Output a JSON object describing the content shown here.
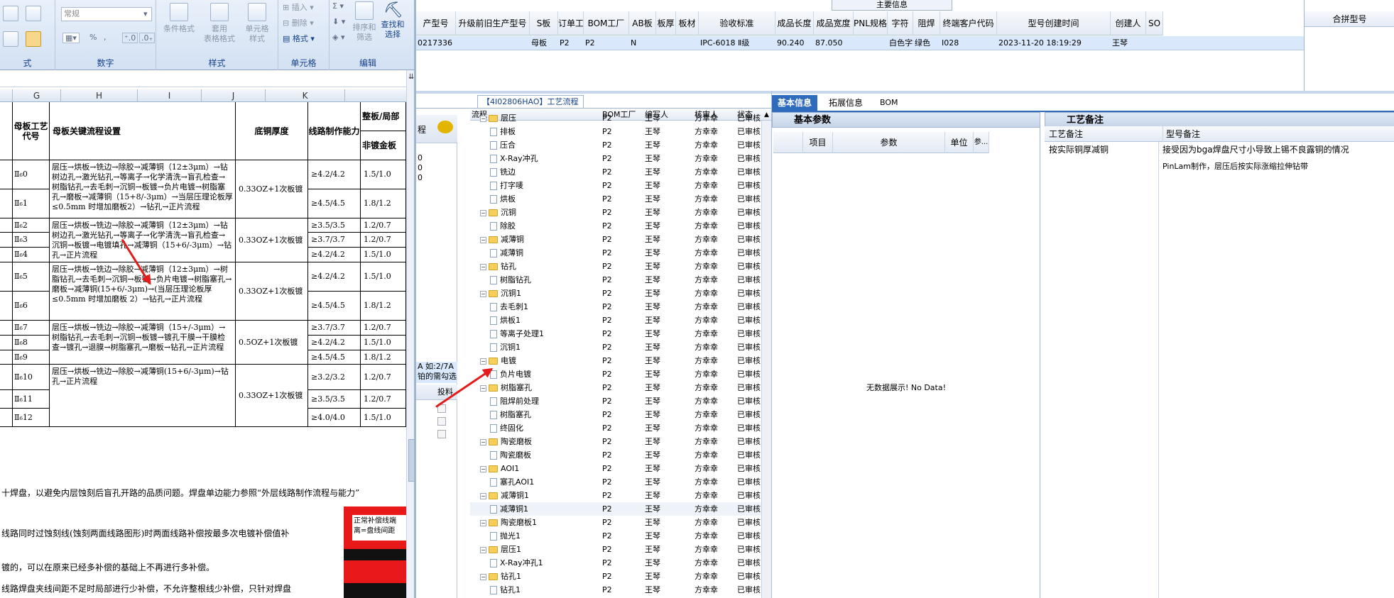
{
  "excel": {
    "ribbon": {
      "number_format_value": "常规",
      "groups": [
        {
          "label": "式"
        },
        {
          "label": "数字"
        },
        {
          "label": "样式"
        },
        {
          "label": "单元格"
        },
        {
          "label": "编辑"
        }
      ],
      "style_buttons": [
        {
          "label": "条件格式"
        },
        {
          "label": "套用\n表格格式"
        },
        {
          "label": "单元格\n样式"
        }
      ],
      "cell_items": [
        "插入",
        "删除",
        "格式"
      ],
      "edit_items": [
        "Σ",
        "排序和\n筛选",
        "查找和\n选择"
      ],
      "percent": "%",
      "comma": ","
    },
    "columns": [
      "G",
      "H",
      "I",
      "J",
      "K"
    ],
    "headers": {
      "code": "母板工艺代号",
      "flow": "母板关键流程设置",
      "cu": "底铜厚度",
      "line": "线路制作能力",
      "plate": "整板/局部",
      "plate_sub": "非镀金板"
    },
    "rows": [
      {
        "code": "Ⅱ₆0",
        "line": "≥4.2/4.2",
        "plate": "1.5/1.0"
      },
      {
        "code": "Ⅱ₆1",
        "line": "≥4.5/4.5",
        "plate": "1.8/1.2"
      },
      {
        "code": "Ⅱ₆2",
        "line": "≥3.5/3.5",
        "plate": "1.2/0.7"
      },
      {
        "code": "Ⅱ₆3",
        "line": "≥3.7/3.7",
        "plate": "1.2/0.7"
      },
      {
        "code": "Ⅱ₆4",
        "line": "≥4.2/4.2",
        "plate": "1.5/1.0"
      },
      {
        "code": "Ⅱ₆5",
        "line": "≥4.2/4.2",
        "plate": "1.5/1.0"
      },
      {
        "code": "Ⅱ₆6",
        "line": "≥4.5/4.5",
        "plate": "1.8/1.2"
      },
      {
        "code": "Ⅱ₆7",
        "line": "≥3.7/3.7",
        "plate": "1.2/0.7"
      },
      {
        "code": "Ⅱ₆8",
        "line": "≥4.2/4.2",
        "plate": "1.5/1.0"
      },
      {
        "code": "Ⅱ₆9",
        "line": "≥4.5/4.5",
        "plate": "1.8/1.2"
      },
      {
        "code": "Ⅱ₆10",
        "line": "≥3.2/3.2",
        "plate": "1.2/0.7"
      },
      {
        "code": "Ⅱ₆11",
        "line": "≥3.5/3.5",
        "plate": "1.2/0.7"
      },
      {
        "code": "Ⅱ₆12",
        "line": "≥4.0/4.0",
        "plate": "1.5/1.0"
      }
    ],
    "flows": [
      {
        "text": "层压→烘板→铣边→除胶→减薄铜（12±3μm）→钻树边孔→激光钻孔→等离子→化学清洗→盲孔检查→树脂钻孔→去毛刺→沉铜→板镀→负片电镀→树脂塞孔→磨板→减薄铜（15+8/-3μm）→当层压理论板厚≤0.5mm 时增加磨板2）→钻孔→正片流程",
        "cu": "0.33OZ+1次板镀"
      },
      {
        "text": "层压→烘板→铣边→除胶→减薄铜（12±3μm）→钻树边孔→激光钻孔→等离子→化学清洗→盲孔检查→沉铜→板镀→电镀填孔→减薄铜（15+6/-3μm）→钻孔→正片流程",
        "cu": "0.33OZ+1次板镀"
      },
      {
        "text": "层压→烘板→铣边→除胶→减薄铜（12±3μm）→树脂钻孔→去毛刺→沉铜→板镀→负片电镀→树脂塞孔→磨板→减薄铜(15+6/-3μm)→(当层压理论板厚≤0.5mm 时增加磨板 2）→钻孔→正片流程",
        "cu": "0.33OZ+1次板镀"
      },
      {
        "text": "层压→烘板→铣边→除胶→减薄铜（15+/-3μm）→树脂钻孔→去毛刺→沉铜→板镀→镀孔干膜→干膜检查→镀孔→退膜→树脂塞孔→磨板→钻孔→正片流程",
        "cu": "0.5OZ+1次板镀"
      },
      {
        "text": "层压→烘板→铣边→除胶→减薄铜(15+6/-3μm)→钻孔→正片流程",
        "cu": "0.33OZ+1次板镀"
      }
    ],
    "doc_lines": [
      "十焊盘，以避免内层蚀刻后盲孔开路的品质问题。焊盘单边能力参照“外层线路制作流程与能力”",
      "线路同时过蚀刻线(蚀刻两面线路图形)时两面线路补偿按最多次电镀补偿值补",
      "镀的，可以在原来已经多补偿的基础上不再进行多补偿。",
      "线路焊盘夹线间距不足时局部进行少补偿，不允许整根线少补偿，只针对焊盘"
    ],
    "note_box": {
      "line1": "正常补偿线端",
      "line2": "离=盘线间距"
    }
  },
  "topgrid": {
    "caption": "主要信息",
    "merge_header": "合拼型号",
    "headers": [
      "产型号",
      "升级前旧生产型号",
      "S板",
      "订单工厂",
      "BOM工厂",
      "AB板",
      "板厚",
      "板材",
      "验收标准",
      "成品长度",
      "成品宽度",
      "PNL规格",
      "字符",
      "阻焊",
      "终端客户代码",
      "型号创建时间",
      "创建人",
      "SO"
    ],
    "row": [
      "0217336",
      "",
      "母板",
      "P2",
      "P2",
      "N",
      "",
      "",
      "IPC-6018 Ⅱ级",
      "90.240",
      "87.050",
      "",
      "白色字符",
      "绿色",
      "I028",
      "2023-11-20 18:19:29",
      "王琴",
      ""
    ]
  },
  "left_panel": {
    "tab_title": "【4I02806HAO】工艺流程",
    "side_tab": "程",
    "side_values": [
      "0",
      "0",
      "0"
    ],
    "side_text1": "A 如:2/7A",
    "side_text2": "铂的需勾选",
    "side_col": "投料",
    "headers": {
      "flow": "流程",
      "bom": "BOM工厂",
      "author": "编写人",
      "reviewer": "核审人",
      "status": "状态"
    },
    "rows": [
      {
        "level": 1,
        "type": "folder",
        "name": "层压",
        "bom": "P2",
        "author": "王琴",
        "reviewer": "方幸幸",
        "status": "已审核"
      },
      {
        "level": 2,
        "type": "doc",
        "name": "排板",
        "bom": "P2",
        "author": "王琴",
        "reviewer": "方幸幸",
        "status": "已审核"
      },
      {
        "level": 2,
        "type": "doc",
        "name": "压合",
        "bom": "P2",
        "author": "王琴",
        "reviewer": "方幸幸",
        "status": "已审核"
      },
      {
        "level": 2,
        "type": "doc",
        "name": "X-Ray冲孔",
        "bom": "P2",
        "author": "王琴",
        "reviewer": "方幸幸",
        "status": "已审核"
      },
      {
        "level": 2,
        "type": "doc",
        "name": "铣边",
        "bom": "P2",
        "author": "王琴",
        "reviewer": "方幸幸",
        "status": "已审核"
      },
      {
        "level": 2,
        "type": "doc",
        "name": "打字唛",
        "bom": "P2",
        "author": "王琴",
        "reviewer": "方幸幸",
        "status": "已审核"
      },
      {
        "level": 2,
        "type": "doc",
        "name": "烘板",
        "bom": "P2",
        "author": "王琴",
        "reviewer": "方幸幸",
        "status": "已审核"
      },
      {
        "level": 1,
        "type": "folder",
        "name": "沉铜",
        "bom": "P2",
        "author": "王琴",
        "reviewer": "方幸幸",
        "status": "已审核"
      },
      {
        "level": 2,
        "type": "doc",
        "name": "除胶",
        "bom": "P2",
        "author": "王琴",
        "reviewer": "方幸幸",
        "status": "已审核"
      },
      {
        "level": 1,
        "type": "folder",
        "name": "减薄铜",
        "bom": "P2",
        "author": "王琴",
        "reviewer": "方幸幸",
        "status": "已审核"
      },
      {
        "level": 2,
        "type": "doc",
        "name": "减薄铜",
        "bom": "P2",
        "author": "王琴",
        "reviewer": "方幸幸",
        "status": "已审核"
      },
      {
        "level": 1,
        "type": "folder",
        "name": "钻孔",
        "bom": "P2",
        "author": "王琴",
        "reviewer": "方幸幸",
        "status": "已审核"
      },
      {
        "level": 2,
        "type": "doc",
        "name": "树脂钻孔",
        "bom": "P2",
        "author": "王琴",
        "reviewer": "方幸幸",
        "status": "已审核"
      },
      {
        "level": 1,
        "type": "folder",
        "name": "沉铜1",
        "bom": "P2",
        "author": "王琴",
        "reviewer": "方幸幸",
        "status": "已审核"
      },
      {
        "level": 2,
        "type": "doc",
        "name": "去毛刺1",
        "bom": "P2",
        "author": "王琴",
        "reviewer": "方幸幸",
        "status": "已审核"
      },
      {
        "level": 2,
        "type": "doc",
        "name": "烘板1",
        "bom": "P2",
        "author": "王琴",
        "reviewer": "方幸幸",
        "status": "已审核"
      },
      {
        "level": 2,
        "type": "doc",
        "name": "等离子处理1",
        "bom": "P2",
        "author": "王琴",
        "reviewer": "方幸幸",
        "status": "已审核"
      },
      {
        "level": 2,
        "type": "doc",
        "name": "沉铜1",
        "bom": "P2",
        "author": "王琴",
        "reviewer": "方幸幸",
        "status": "已审核"
      },
      {
        "level": 1,
        "type": "folder",
        "name": "电镀",
        "bom": "P2",
        "author": "王琴",
        "reviewer": "方幸幸",
        "status": "已审核"
      },
      {
        "level": 2,
        "type": "doc",
        "name": "负片电镀",
        "bom": "P2",
        "author": "王琴",
        "reviewer": "方幸幸",
        "status": "已审核"
      },
      {
        "level": 1,
        "type": "folder",
        "name": "树脂塞孔",
        "bom": "P2",
        "author": "王琴",
        "reviewer": "方幸幸",
        "status": "已审核"
      },
      {
        "level": 2,
        "type": "doc",
        "name": "阻焊前处理",
        "bom": "P2",
        "author": "王琴",
        "reviewer": "方幸幸",
        "status": "已审核"
      },
      {
        "level": 2,
        "type": "doc",
        "name": "树脂塞孔",
        "bom": "P2",
        "author": "王琴",
        "reviewer": "方幸幸",
        "status": "已审核"
      },
      {
        "level": 2,
        "type": "doc",
        "name": "终固化",
        "bom": "P2",
        "author": "王琴",
        "reviewer": "方幸幸",
        "status": "已审核"
      },
      {
        "level": 1,
        "type": "folder",
        "name": "陶瓷磨板",
        "bom": "P2",
        "author": "王琴",
        "reviewer": "方幸幸",
        "status": "已审核"
      },
      {
        "level": 2,
        "type": "doc",
        "name": "陶瓷磨板",
        "bom": "P2",
        "author": "王琴",
        "reviewer": "方幸幸",
        "status": "已审核"
      },
      {
        "level": 1,
        "type": "folder",
        "name": "AOI1",
        "bom": "P2",
        "author": "王琴",
        "reviewer": "方幸幸",
        "status": "已审核"
      },
      {
        "level": 2,
        "type": "doc",
        "name": "塞孔AOI1",
        "bom": "P2",
        "author": "王琴",
        "reviewer": "方幸幸",
        "status": "已审核"
      },
      {
        "level": 1,
        "type": "folder",
        "name": "减薄铜1",
        "bom": "P2",
        "author": "王琴",
        "reviewer": "方幸幸",
        "status": "已审核"
      },
      {
        "level": 2,
        "type": "doc",
        "name": "减薄铜1",
        "bom": "P2",
        "author": "王琴",
        "reviewer": "方幸幸",
        "status": "已审核"
      },
      {
        "level": 1,
        "type": "folder",
        "name": "陶瓷磨板1",
        "bom": "P2",
        "author": "王琴",
        "reviewer": "方幸幸",
        "status": "已审核"
      },
      {
        "level": 2,
        "type": "doc",
        "name": "抛光1",
        "bom": "P2",
        "author": "王琴",
        "reviewer": "方幸幸",
        "status": "已审核"
      },
      {
        "level": 1,
        "type": "folder",
        "name": "层压1",
        "bom": "P2",
        "author": "王琴",
        "reviewer": "方幸幸",
        "status": "已审核"
      },
      {
        "level": 2,
        "type": "doc",
        "name": "X-Ray冲孔1",
        "bom": "P2",
        "author": "王琴",
        "reviewer": "方幸幸",
        "status": "已审核"
      },
      {
        "level": 1,
        "type": "folder",
        "name": "钻孔1",
        "bom": "P2",
        "author": "王琴",
        "reviewer": "方幸幸",
        "status": "已审核"
      },
      {
        "level": 2,
        "type": "doc",
        "name": "钻孔1",
        "bom": "P2",
        "author": "王琴",
        "reviewer": "方幸幸",
        "status": "已审核"
      }
    ]
  },
  "info_panel": {
    "tabs": [
      "基本信息",
      "拓展信息",
      "BOM"
    ],
    "basic_title": "基本参数",
    "grid_headers": [
      "项目",
      "参数",
      "单位",
      "参..."
    ],
    "no_data": "无数据展示! No Data!",
    "remark_title": "工艺备注",
    "remark_headers": [
      "工艺备注",
      "型号备注"
    ],
    "remark_rows": [
      {
        "craft": "按实际铜厚减铜",
        "model": "接受因为bga焊盘尺寸小导致上锡不良露铜的情况"
      },
      {
        "craft": "",
        "model": "PinLam制作，层压后按实际涨缩拉伸钻带"
      }
    ]
  },
  "colors": {
    "accent": "#2f6bbd",
    "arrow": "#e31b1b",
    "selected_row": "#d9e8fb"
  }
}
